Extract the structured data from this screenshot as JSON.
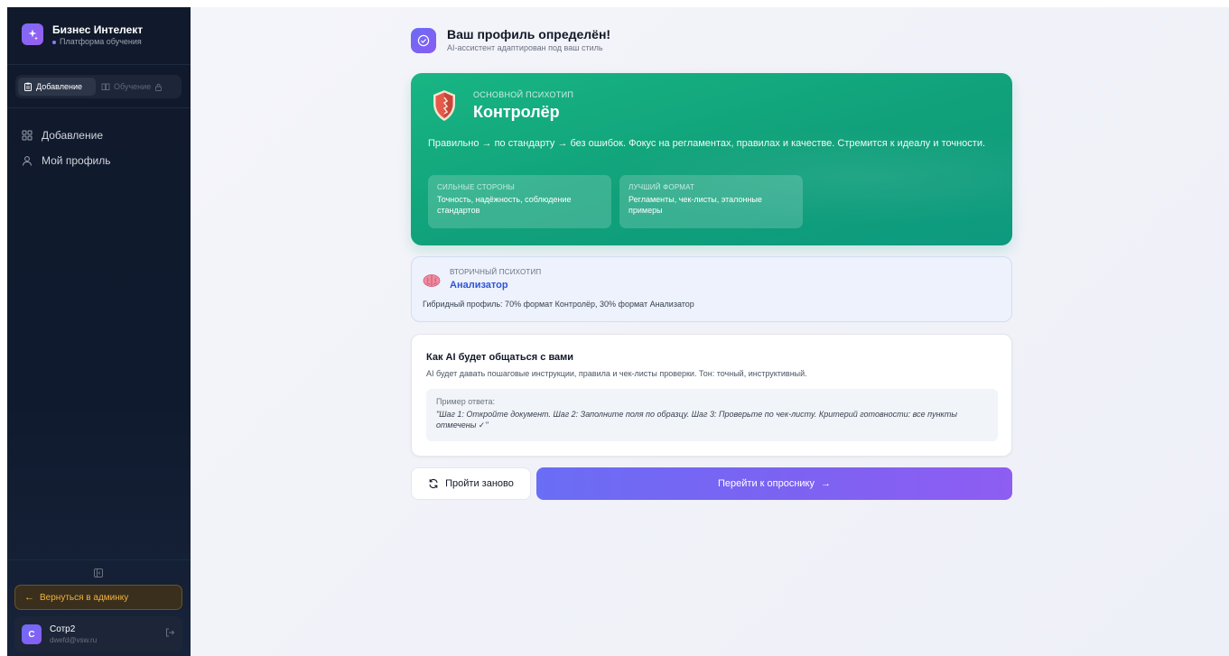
{
  "app": {
    "title": "Бизнес Интелект",
    "subtitle": "Платформа обучения"
  },
  "mode_switch": {
    "active_label": "Добавление",
    "disabled_label": "Обучение"
  },
  "nav": {
    "items": [
      {
        "label": "Добавление",
        "icon": "grid-icon"
      },
      {
        "label": "Мой профиль",
        "icon": "user-icon"
      }
    ]
  },
  "sidebar_footer": {
    "back_label": "Вернуться в админку",
    "user": {
      "initial": "С",
      "name": "Сотр2",
      "email": "dwefd@vsw.ru"
    }
  },
  "header": {
    "title": "Ваш профиль определён!",
    "subtitle": "AI-ассистент адаптирован под ваш стиль"
  },
  "primary": {
    "label": "ОСНОВНОЙ ПСИХОТИП",
    "name": "Контролёр",
    "description": "Правильно → по стандарту → без ошибок. Фокус на регламентах, правилах и качестве. Стремится к идеалу и точности.",
    "strengths_label": "СИЛЬНЫЕ СТОРОНЫ",
    "strengths_value": "Точность, надёжность, соблюдение стандартов",
    "format_label": "ЛУЧШИЙ ФОРМАТ",
    "format_value": "Регламенты, чек-листы, эталонные примеры"
  },
  "secondary": {
    "label": "ВТОРИЧНЫЙ ПСИХОТИП",
    "name": "Анализатор",
    "description": "Гибридный профиль: 70% формат Контролёр, 30% формат Анализатор"
  },
  "ai": {
    "title": "Как AI будет общаться с вами",
    "description": "AI будет давать пошаговые инструкции, правила и чек-листы проверки. Тон: точный, инструктивный.",
    "example_label": "Пример ответа:",
    "example_text": "\"Шаг 1: Откройте документ. Шаг 2: Заполните поля по образцу. Шаг 3: Проверьте по чек-листу. Критерий готовности: все пункты отмечены ✓\""
  },
  "actions": {
    "retry_label": "Пройти заново",
    "next_label": "Перейти к опроснику",
    "next_arrow": "→"
  },
  "colors": {
    "accent": "#7b63f2",
    "primary_card": "#10a07a",
    "secondary_link": "#2f55d4",
    "back_button": "#f2b33d"
  }
}
